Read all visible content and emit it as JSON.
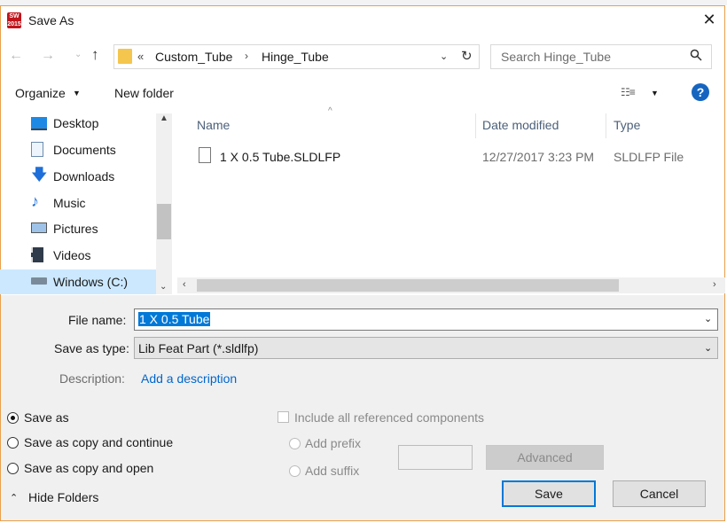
{
  "window": {
    "title": "Save As"
  },
  "address": {
    "overflow": "«",
    "crumbs": [
      "Custom_Tube",
      "Hinge_Tube"
    ],
    "separator": "›"
  },
  "search": {
    "placeholder": "Search Hinge_Tube"
  },
  "toolbar": {
    "organize_label": "Organize",
    "new_folder_label": "New folder",
    "help_label": "?"
  },
  "nav": {
    "items": [
      {
        "label": "Desktop",
        "icon": "desktop-icon"
      },
      {
        "label": "Documents",
        "icon": "documents-icon"
      },
      {
        "label": "Downloads",
        "icon": "downloads-icon"
      },
      {
        "label": "Music",
        "icon": "music-icon"
      },
      {
        "label": "Pictures",
        "icon": "pictures-icon"
      },
      {
        "label": "Videos",
        "icon": "videos-icon"
      },
      {
        "label": "Windows (C:)",
        "icon": "drive-icon"
      }
    ],
    "selected": "Windows (C:)"
  },
  "columns": {
    "name": "Name",
    "date": "Date modified",
    "type": "Type"
  },
  "files": [
    {
      "name": "1 X 0.5 Tube.SLDLFP",
      "date": "12/27/2017 3:23 PM",
      "type": "SLDLFP File"
    }
  ],
  "form": {
    "file_name_label": "File name:",
    "file_name_value": "1 X 0.5 Tube",
    "save_type_label": "Save as type:",
    "save_type_value": "Lib Feat Part (*.sldlfp)",
    "description_label": "Description:",
    "description_link": "Add a description"
  },
  "options": {
    "save_modes": [
      {
        "label": "Save as",
        "selected": true
      },
      {
        "label": "Save as copy and continue",
        "selected": false
      },
      {
        "label": "Save as copy and open",
        "selected": false
      }
    ],
    "include_refs_label": "Include all referenced components",
    "add_prefix_label": "Add prefix",
    "add_suffix_label": "Add suffix",
    "advanced_label": "Advanced"
  },
  "footer": {
    "hide_folders_label": "Hide Folders",
    "save_label": "Save",
    "cancel_label": "Cancel"
  },
  "colors": {
    "accent": "#0078d7",
    "selection": "#cce8ff",
    "border": "#e8a04c",
    "link": "#0066cc"
  }
}
